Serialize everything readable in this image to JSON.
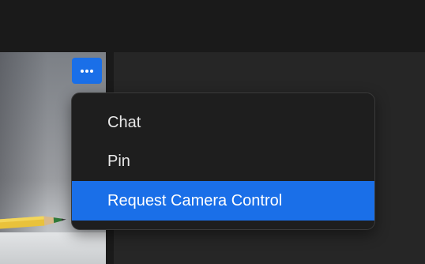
{
  "window": {
    "more_button_icon": "more-horizontal-icon"
  },
  "context_menu": {
    "items": [
      {
        "label": "Chat",
        "highlighted": false
      },
      {
        "label": "Pin",
        "highlighted": false
      },
      {
        "label": "Request Camera Control",
        "highlighted": true
      }
    ]
  },
  "colors": {
    "accent": "#1a6fe8",
    "menu_background": "#1e1e1e",
    "app_background": "#242424"
  }
}
